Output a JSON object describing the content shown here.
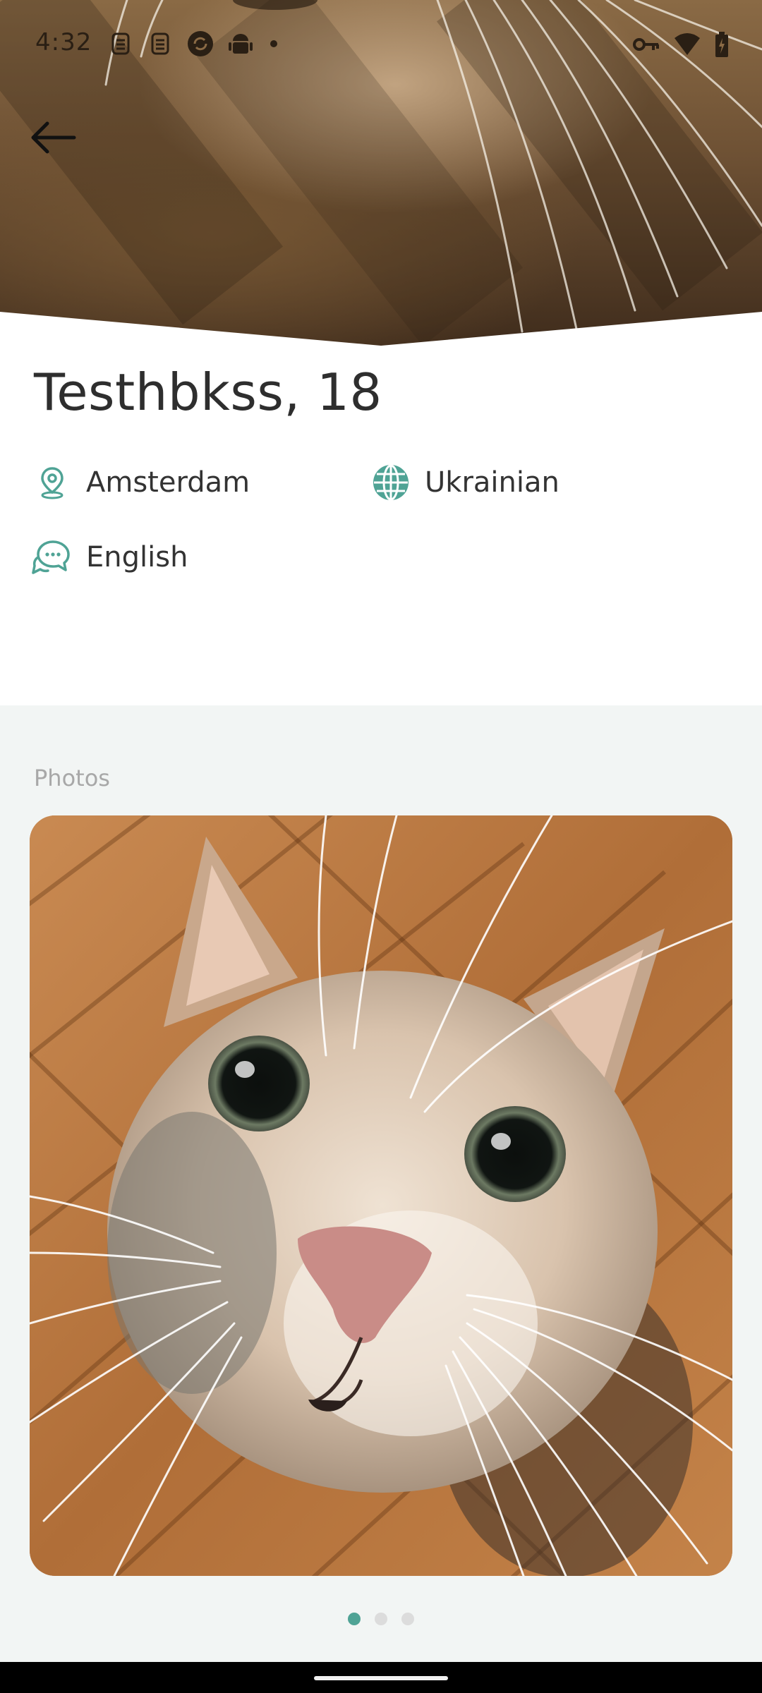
{
  "status_bar": {
    "time": "4:32",
    "left_icons": [
      "sim-icon",
      "sim-icon",
      "sync-icon",
      "android-icon",
      "dot-icon"
    ],
    "right_icons": [
      "vpn-key-icon",
      "wifi-icon",
      "battery-icon"
    ]
  },
  "profile": {
    "name_age": "Testhbkss, 18",
    "location": "Amsterdam",
    "nationality": "Ukrainian",
    "language": "English"
  },
  "photos": {
    "label": "Photos",
    "count": 3,
    "active_index": 0
  },
  "colors": {
    "accent": "#4fa395",
    "section_bg": "#f2f5f4",
    "muted_text": "#a8a8a8"
  }
}
